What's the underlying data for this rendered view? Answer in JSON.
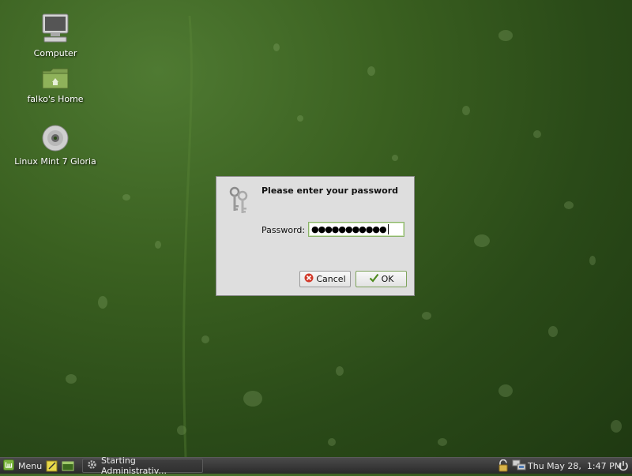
{
  "desktop": {
    "icons": [
      {
        "label": "Computer",
        "icon": "computer-icon"
      },
      {
        "label": "falko's Home",
        "icon": "home-folder-icon"
      },
      {
        "label": "Linux Mint 7 Gloria",
        "icon": "cd-disc-icon"
      }
    ]
  },
  "dialog": {
    "title": "Please enter your password",
    "password_label": "Password:",
    "password_value": "●●●●●●●●●●●",
    "cancel_label": "Cancel",
    "ok_label": "OK",
    "icon": "keys-icon"
  },
  "panel": {
    "menu_label": "Menu",
    "task_label": "Starting Administrativ...",
    "clock": "Thu May 28,  1:47 PM"
  },
  "colors": {
    "panel": "#2e2e2e",
    "accent": "#6a9c2e"
  }
}
